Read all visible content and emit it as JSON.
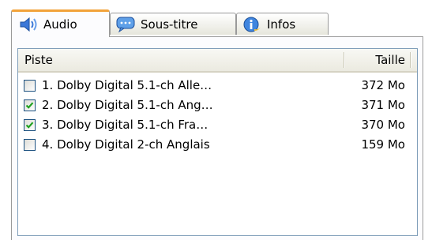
{
  "tabs": [
    {
      "label": "Audio",
      "icon": "speaker-icon",
      "active": true
    },
    {
      "label": "Sous-titre",
      "icon": "speech-bubble-icon",
      "active": false
    },
    {
      "label": "Infos",
      "icon": "info-icon",
      "active": false
    }
  ],
  "list": {
    "columns": {
      "track": "Piste",
      "size": "Taille"
    },
    "rows": [
      {
        "name": "1. Dolby Digital 5.1-ch Alle…",
        "size": "372 Mo",
        "checked": false
      },
      {
        "name": "2. Dolby Digital 5.1-ch Ang…",
        "size": "371 Mo",
        "checked": true
      },
      {
        "name": "3. Dolby Digital 5.1-ch Fra…",
        "size": "370 Mo",
        "checked": true
      },
      {
        "name": "4. Dolby Digital 2-ch Anglais",
        "size": "159 Mo",
        "checked": false
      }
    ]
  },
  "colors": {
    "active_tab_accent": "#f2a23a",
    "checkmark": "#21a121",
    "list_border": "#7f9db9"
  }
}
